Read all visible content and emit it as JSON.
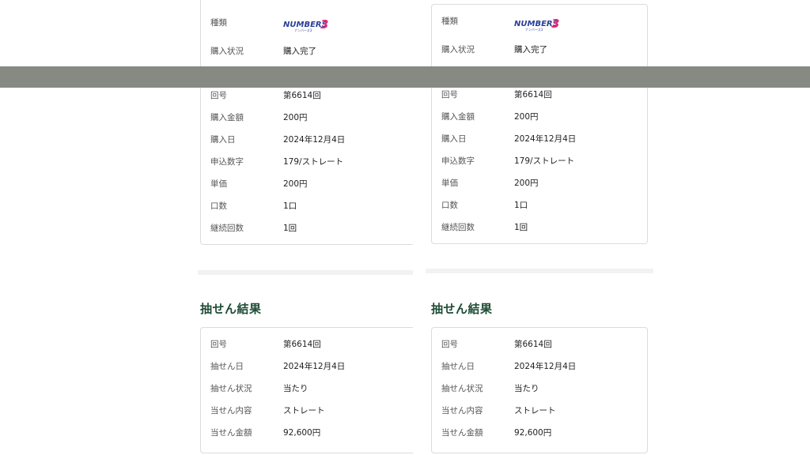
{
  "panels": [
    {
      "purchase": {
        "type_label": "種類",
        "logo_text": "NUMBERS",
        "logo_digit": "3",
        "logo_sub": "ナンバーズ3",
        "rows_top": [
          {
            "label": "購入状況",
            "value": "購入完了"
          }
        ],
        "rows": [
          {
            "label": "回号",
            "value": "第6614回"
          },
          {
            "label": "購入金額",
            "value": "200円"
          },
          {
            "label": "購入日",
            "value": "2024年12月4日"
          },
          {
            "label": "申込数字",
            "value": "179/ストレート"
          },
          {
            "label": "単価",
            "value": "200円"
          },
          {
            "label": "口数",
            "value": "1口"
          },
          {
            "label": "継続回数",
            "value": "1回"
          }
        ]
      },
      "result": {
        "heading": "抽せん結果",
        "rows": [
          {
            "label": "回号",
            "value": "第6614回"
          },
          {
            "label": "抽せん日",
            "value": "2024年12月4日"
          },
          {
            "label": "抽せん状況",
            "value": "当たり"
          },
          {
            "label": "当せん内容",
            "value": "ストレート"
          },
          {
            "label": "当せん金額",
            "value": "92,600円"
          }
        ]
      }
    },
    {
      "purchase": {
        "type_label": "種類",
        "logo_text": "NUMBERS",
        "logo_digit": "3",
        "logo_sub": "ナンバーズ3",
        "rows_top": [
          {
            "label": "購入状況",
            "value": "購入完了"
          }
        ],
        "rows": [
          {
            "label": "回号",
            "value": "第6614回"
          },
          {
            "label": "購入金額",
            "value": "200円"
          },
          {
            "label": "購入日",
            "value": "2024年12月4日"
          },
          {
            "label": "申込数字",
            "value": "179/ストレート"
          },
          {
            "label": "単価",
            "value": "200円"
          },
          {
            "label": "口数",
            "value": "1口"
          },
          {
            "label": "継続回数",
            "value": "1回"
          }
        ]
      },
      "result": {
        "heading": "抽せん結果",
        "rows": [
          {
            "label": "回号",
            "value": "第6614回"
          },
          {
            "label": "抽せん日",
            "value": "2024年12月4日"
          },
          {
            "label": "抽せん状況",
            "value": "当たり"
          },
          {
            "label": "当せん内容",
            "value": "ストレート"
          },
          {
            "label": "当せん金額",
            "value": "92,600円"
          }
        ]
      }
    }
  ],
  "colors": {
    "heading": "#1f4d36",
    "logo_blue": "#2a3f9c",
    "logo_pink": "#e0287a",
    "overlay": "#878a83"
  }
}
